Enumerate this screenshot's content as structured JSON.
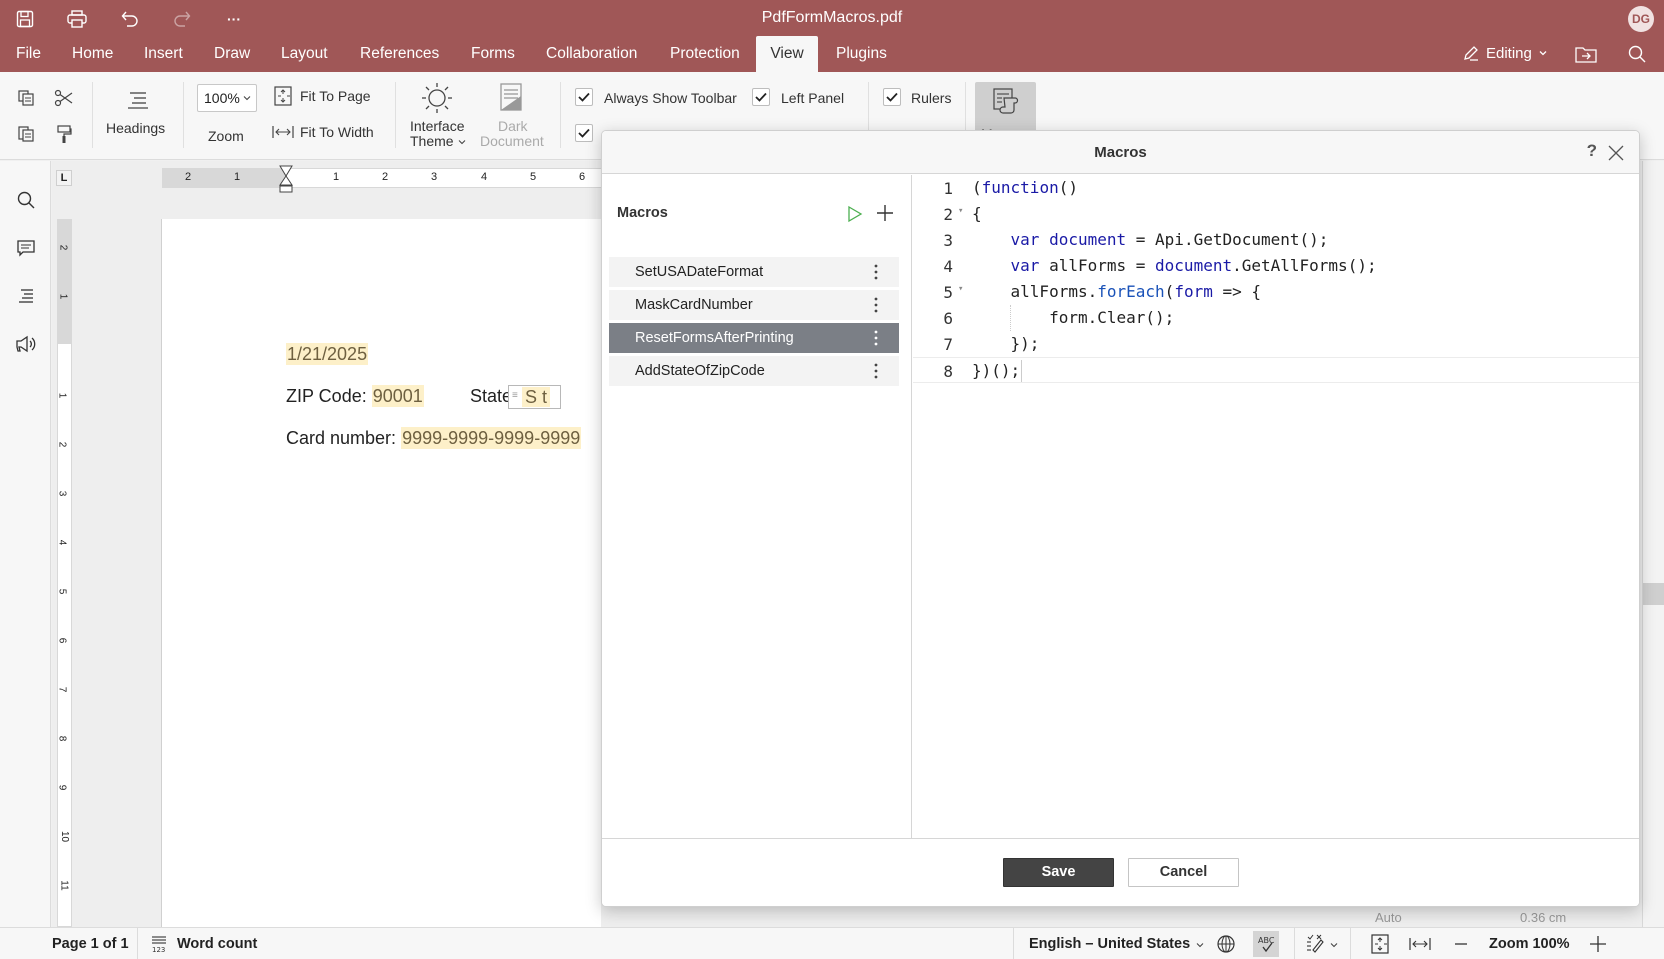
{
  "window": {
    "title": "PdfFormMacros.pdf",
    "user_initials": "DG",
    "accent_color": "#a05757"
  },
  "quick_access": {
    "icons": [
      "save-icon",
      "print-icon",
      "undo-icon",
      "redo-icon",
      "more-icon"
    ],
    "more_label": "···"
  },
  "tabs": [
    {
      "label": "File"
    },
    {
      "label": "Home"
    },
    {
      "label": "Insert"
    },
    {
      "label": "Draw"
    },
    {
      "label": "Layout"
    },
    {
      "label": "References"
    },
    {
      "label": "Forms"
    },
    {
      "label": "Collaboration"
    },
    {
      "label": "Protection"
    },
    {
      "label": "View",
      "active": true
    },
    {
      "label": "Plugins"
    }
  ],
  "header_right": {
    "mode_label": "Editing"
  },
  "ribbon": {
    "headings_label": "Headings",
    "zoom_value": "100%",
    "zoom_label": "Zoom",
    "fit_to_page": "Fit To Page",
    "fit_to_width": "Fit To Width",
    "interface_theme_line1": "Interface",
    "interface_theme_line2": "Theme",
    "dark_document_line1": "Dark",
    "dark_document_line2": "Document",
    "always_show_toolbar": "Always Show Toolbar",
    "always_show_toolbar_checked": true,
    "left_panel": "Left Panel",
    "left_panel_checked": true,
    "rulers": "Rulers",
    "rulers_checked": true,
    "macros_label": "Macros"
  },
  "ruler": {
    "corner": "L",
    "h_labels_left": [
      "2",
      "1"
    ],
    "h_labels_right": [
      "1",
      "2",
      "3",
      "4",
      "5",
      "6"
    ],
    "v_labels_top": [
      "2",
      "1"
    ],
    "v_labels": [
      "1",
      "2",
      "3",
      "4",
      "5",
      "6",
      "7",
      "8",
      "9",
      "10",
      "11"
    ]
  },
  "document": {
    "date_field": "1/21/2025",
    "zip_label": "ZIP Code:",
    "zip_value": "90001",
    "state_label": "State",
    "state_value": "S  t",
    "card_label": "Card number:",
    "card_value": "9999-9999-9999-9999"
  },
  "dialog": {
    "title": "Macros",
    "help": "?",
    "list_title": "Macros",
    "macros": [
      {
        "name": "SetUSADateFormat",
        "selected": false
      },
      {
        "name": "MaskCardNumber",
        "selected": false
      },
      {
        "name": "ResetFormsAfterPrinting",
        "selected": true
      },
      {
        "name": "AddStateOfZipCode",
        "selected": false
      }
    ],
    "code_lines": [
      {
        "n": "1",
        "fold": false
      },
      {
        "n": "2",
        "fold": true
      },
      {
        "n": "3",
        "fold": false
      },
      {
        "n": "4",
        "fold": false
      },
      {
        "n": "5",
        "fold": true
      },
      {
        "n": "6",
        "fold": false
      },
      {
        "n": "7",
        "fold": false
      },
      {
        "n": "8",
        "fold": false
      }
    ],
    "code": {
      "l1_a": "(",
      "l1_kw": "function",
      "l1_b": "()",
      "l2": "{",
      "l3_kw": "var",
      "l3_var": "document",
      "l3_rest": " = Api.GetDocument();",
      "l4_kw": "var",
      "l4_mid": " allForms = ",
      "l4_var": "document",
      "l4_rest": ".GetAllForms();",
      "l5_a": "allForms.",
      "l5_fn": "forEach",
      "l5_b": "(",
      "l5_var": "form",
      "l5_rest": " => {",
      "l6": "form.Clear();",
      "l7": "});",
      "l8": "})();"
    },
    "save_label": "Save",
    "cancel_label": "Cancel"
  },
  "statusbar": {
    "page_info": "Page 1 of 1",
    "word_count": "Word count",
    "language": "English – United States",
    "zoom_label": "Zoom 100%",
    "behind_auto": "Auto",
    "behind_cm": "0.36 cm"
  }
}
